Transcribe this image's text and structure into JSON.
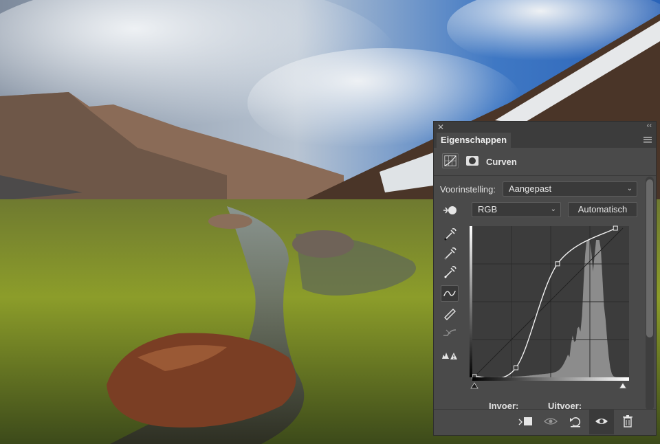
{
  "panel": {
    "title": "Eigenschappen",
    "adjustment_name": "Curven",
    "preset_label": "Voorinstelling:",
    "preset_value": "Aangepast",
    "channel_value": "RGB",
    "auto_button": "Automatisch",
    "input_label": "Invoer:",
    "output_label": "Uitvoer:"
  },
  "curve": {
    "points": [
      [
        0,
        0
      ],
      [
        28,
        6
      ],
      [
        56,
        76
      ],
      [
        95,
        100
      ]
    ],
    "histogram_peak_region": "highlights"
  },
  "icons": {
    "close": "close-icon",
    "collapse": "double-chevron-icon",
    "menu": "panel-menu-icon"
  },
  "colors": {
    "panel_bg": "#4a4a4a",
    "panel_dark": "#3c3c3c",
    "text": "#e6e6e6"
  }
}
